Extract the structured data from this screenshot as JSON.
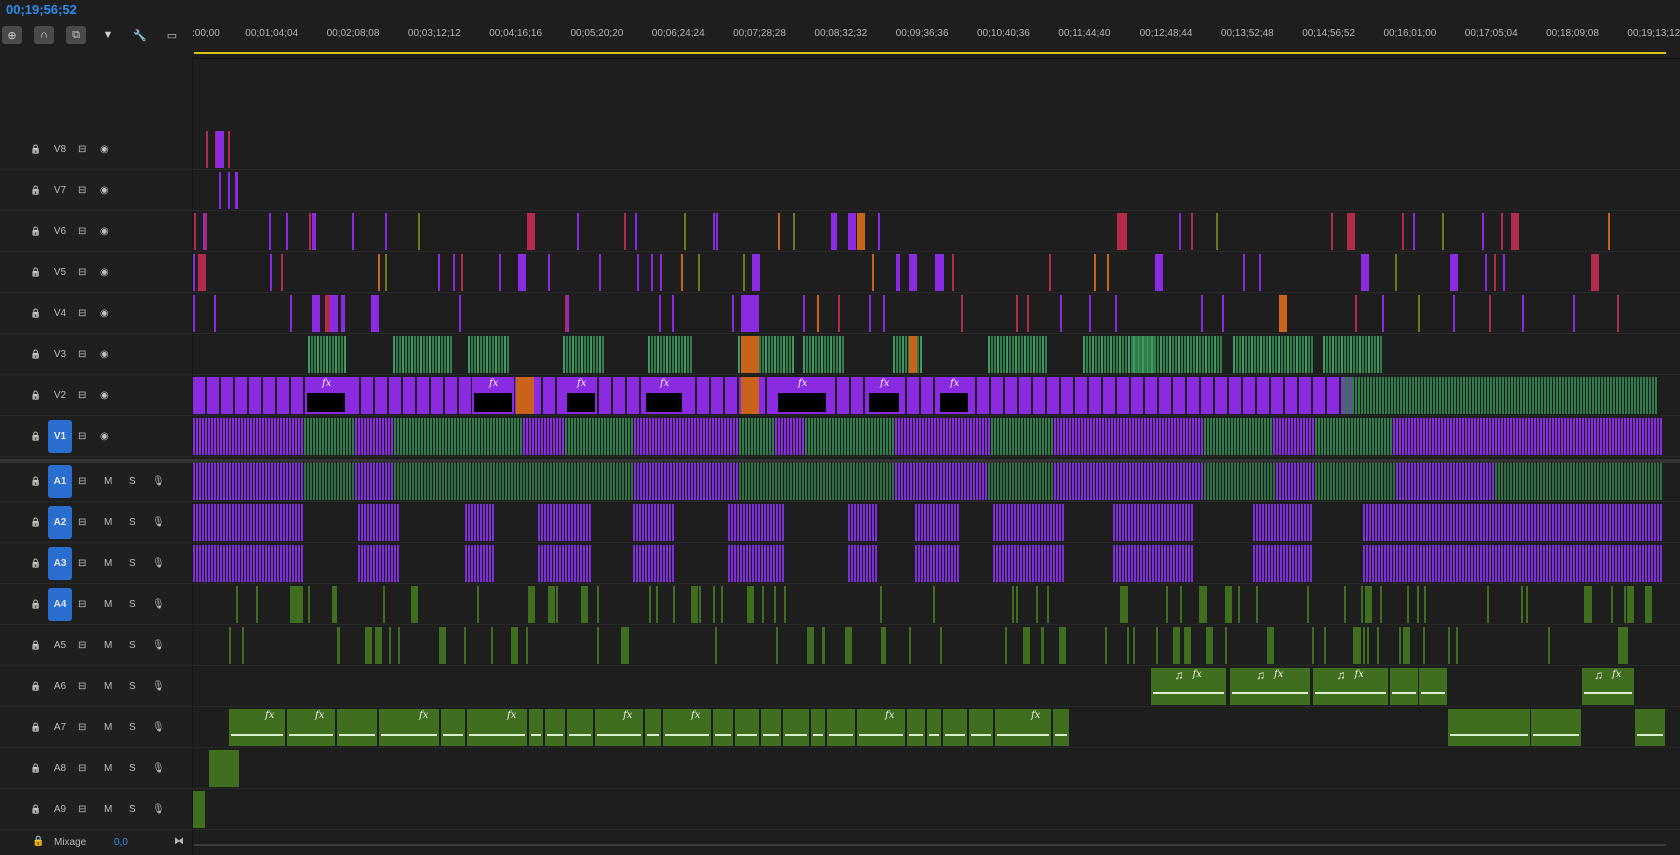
{
  "timecode": "00;19;56;52",
  "toolbar": {
    "icons": [
      "snap-icon",
      "magnet-link-icon",
      "linked-selection-icon",
      "add-marker-icon",
      "wrench-icon",
      "captions-icon"
    ]
  },
  "ruler": {
    "labels": [
      ":00;00",
      "00;01;04;04",
      "00;02;08;08",
      "00;03;12;12",
      "00;04;16;16",
      "00;05;20;20",
      "00;06;24;24",
      "00;07;28;28",
      "00;08;32;32",
      "00;09;36;36",
      "00;10;40;36",
      "00;11;44;40",
      "00;12;48;44",
      "00;13;52;48",
      "00;14;56;52",
      "00;16;01;00",
      "00;17;05;04",
      "00;18;09;08",
      "00;19;13;12"
    ]
  },
  "video_tracks": [
    {
      "label": "V8",
      "selected": false
    },
    {
      "label": "V7",
      "selected": false
    },
    {
      "label": "V6",
      "selected": false
    },
    {
      "label": "V5",
      "selected": false
    },
    {
      "label": "V4",
      "selected": false
    },
    {
      "label": "V3",
      "selected": false
    },
    {
      "label": "V2",
      "selected": false
    },
    {
      "label": "V1",
      "selected": true
    }
  ],
  "audio_tracks": [
    {
      "label": "A1",
      "selected": true,
      "mute": "M",
      "solo": "S"
    },
    {
      "label": "A2",
      "selected": true,
      "mute": "M",
      "solo": "S"
    },
    {
      "label": "A3",
      "selected": true,
      "mute": "M",
      "solo": "S"
    },
    {
      "label": "A4",
      "selected": true,
      "mute": "M",
      "solo": "S"
    },
    {
      "label": "A5",
      "selected": false,
      "mute": "M",
      "solo": "S"
    },
    {
      "label": "A6",
      "selected": false,
      "mute": "M",
      "solo": "S"
    },
    {
      "label": "A7",
      "selected": false,
      "mute": "M",
      "solo": "S"
    },
    {
      "label": "A8",
      "selected": false,
      "mute": "M",
      "solo": "S"
    },
    {
      "label": "A9",
      "selected": false,
      "mute": "M",
      "solo": "S"
    }
  ],
  "mix": {
    "label": "Mixage",
    "value": "0,0"
  },
  "clip_labels": {
    "fx": "fx",
    "note": "♫"
  },
  "colors": {
    "timecode": "#2d8ceb",
    "selected_track": "#2a6fd0",
    "video_purple": "#8a2be2",
    "video_green": "#2e7d4a",
    "video_orange": "#c9621a",
    "audio_green": "#3f6e1e",
    "audio_purple": "#7d2ed6",
    "workbar": "#d9c31a"
  }
}
